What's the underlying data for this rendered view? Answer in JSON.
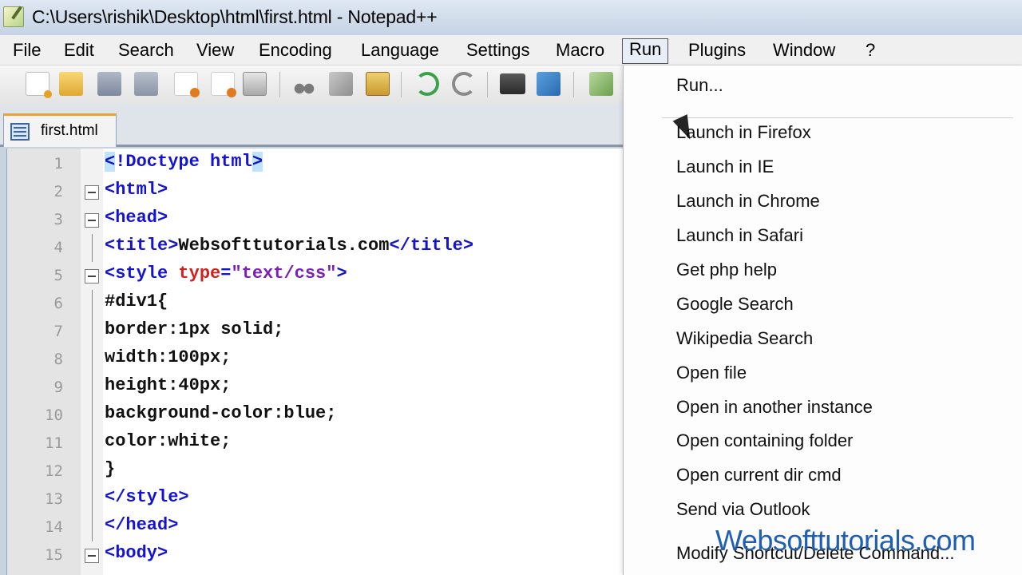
{
  "window": {
    "title": "C:\\Users\\rishik\\Desktop\\html\\first.html - Notepad++"
  },
  "menubar": {
    "items": [
      "File",
      "Edit",
      "Search",
      "View",
      "Encoding",
      "Language",
      "Settings",
      "Macro",
      "Run",
      "Plugins",
      "Window",
      "?"
    ],
    "open_item": "Run"
  },
  "toolbar": {
    "buttons": [
      "new-file-icon",
      "open-file-icon",
      "save-icon",
      "save-all-icon",
      "close-icon",
      "close-all-icon",
      "print-icon",
      "cut-icon",
      "copy-icon",
      "paste-icon",
      "undo-icon",
      "redo-icon",
      "find-icon",
      "replace-icon",
      "run-macro-icon"
    ]
  },
  "tabs": [
    {
      "label": "first.html",
      "active": true
    }
  ],
  "editor": {
    "lines": [
      {
        "n": "1",
        "text": "<!Doctype html>"
      },
      {
        "n": "2",
        "text": "<html>"
      },
      {
        "n": "3",
        "text": "<head>"
      },
      {
        "n": "4",
        "text": "<title>Websofttutorials.com</title>"
      },
      {
        "n": "5",
        "text": "<style type=\"text/css\">"
      },
      {
        "n": "6",
        "text": "#div1{"
      },
      {
        "n": "7",
        "text": "border:1px solid;"
      },
      {
        "n": "8",
        "text": "width:100px;"
      },
      {
        "n": "9",
        "text": "height:40px;"
      },
      {
        "n": "10",
        "text": "background-color:blue;"
      },
      {
        "n": "11",
        "text": "color:white;"
      },
      {
        "n": "12",
        "text": "}"
      },
      {
        "n": "13",
        "text": "</style>"
      },
      {
        "n": "14",
        "text": "</head>"
      },
      {
        "n": "15",
        "text": "<body>"
      }
    ]
  },
  "run_menu": {
    "items": [
      "Run...",
      "Launch in Firefox",
      "Launch in IE",
      "Launch in Chrome",
      "Launch in Safari",
      "Get php help",
      "Google Search",
      "Wikipedia Search",
      "Open file",
      "Open in another instance",
      "Open containing folder",
      "Open current dir cmd",
      "Send via Outlook",
      "Modify Shortcut/Delete Command..."
    ]
  },
  "watermark": "Websofttutorials.com",
  "colors": {
    "tag": "#1414d0",
    "attribute": "#d02020",
    "string": "#7a1fb8",
    "tab_accent": "#f0a030"
  }
}
